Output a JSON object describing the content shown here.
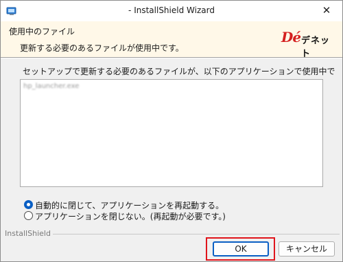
{
  "window": {
    "title": "- InstallShield Wizard"
  },
  "header": {
    "title": "使用中のファイル",
    "subtitle": "更新する必要のあるファイルが使用中です。",
    "logo": {
      "mark": "Dé",
      "name": "デネット",
      "accent": "#d41f1f"
    }
  },
  "main": {
    "description": "セットアップで更新する必要のあるファイルが、以下のアプリケーションで使用中です。",
    "files_in_use": [
      "hp_launcher.exe"
    ]
  },
  "options": [
    {
      "label": "自動的に閉じて、アプリケーションを再起動する。",
      "selected": true
    },
    {
      "label": "アプリケーションを閉じない。(再起動が必要です。)",
      "selected": false
    }
  ],
  "footer": {
    "group_label": "InstallShield",
    "ok_label": "OK",
    "cancel_label": "キャンセル",
    "highlight_color": "#e0141b"
  },
  "icons": {
    "app": "installer-icon",
    "close": "close-icon"
  }
}
